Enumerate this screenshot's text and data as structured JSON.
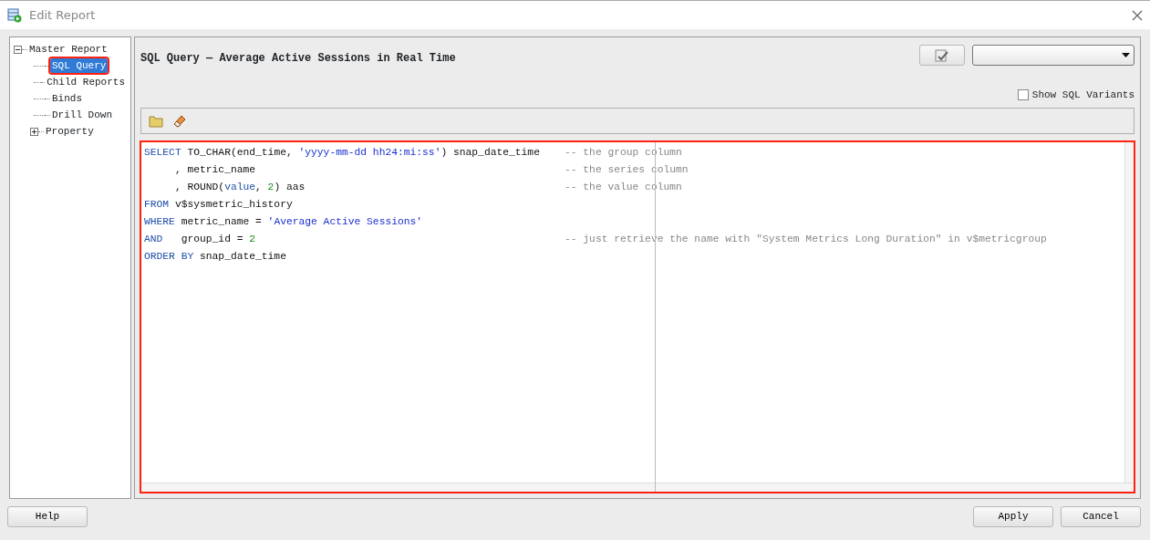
{
  "window": {
    "title": "Edit Report"
  },
  "tree": [
    {
      "label": "Master Report",
      "expanded": true,
      "selected": false,
      "highlighted": false,
      "children": [
        {
          "label": "SQL Query",
          "selected": true,
          "highlighted": true
        },
        {
          "label": "Child Reports",
          "selected": false,
          "highlighted": false
        },
        {
          "label": "Binds",
          "selected": false,
          "highlighted": false
        },
        {
          "label": "Drill Down",
          "selected": false,
          "highlighted": false
        },
        {
          "label": "Property",
          "expanded": false,
          "selected": false,
          "highlighted": false
        }
      ]
    }
  ],
  "panel": {
    "title": "SQL Query — Average Active Sessions in Real Time",
    "show_sql_variants": {
      "label": "Show SQL Variants",
      "checked": false
    }
  },
  "editor": {
    "highlighted": true,
    "lines": [
      {
        "tokens": [
          {
            "kind": "keyword",
            "text": "SELECT"
          },
          {
            "kind": "plain",
            "text": " TO_CHAR(end_time, "
          },
          {
            "kind": "string",
            "text": "'yyyy-mm-dd hh24:mi:ss'"
          },
          {
            "kind": "plain",
            "text": ") snap_date_time"
          }
        ],
        "comment": "-- the group column"
      },
      {
        "tokens": [
          {
            "kind": "plain",
            "text": "     , metric_name"
          }
        ],
        "comment": "-- the series column"
      },
      {
        "tokens": [
          {
            "kind": "plain",
            "text": "     , ROUND("
          },
          {
            "kind": "keyword",
            "text": "value"
          },
          {
            "kind": "plain",
            "text": ", "
          },
          {
            "kind": "number",
            "text": "2"
          },
          {
            "kind": "plain",
            "text": ") aas"
          }
        ],
        "comment": "-- the value column"
      },
      {
        "tokens": [
          {
            "kind": "keyword",
            "text": "FROM"
          },
          {
            "kind": "plain",
            "text": " v$sysmetric_history"
          }
        ]
      },
      {
        "tokens": [
          {
            "kind": "keyword",
            "text": "WHERE"
          },
          {
            "kind": "plain",
            "text": " metric_name = "
          },
          {
            "kind": "string",
            "text": "'Average Active Sessions'"
          }
        ]
      },
      {
        "tokens": [
          {
            "kind": "keyword",
            "text": "AND"
          },
          {
            "kind": "plain",
            "text": "   group_id = "
          },
          {
            "kind": "number",
            "text": "2"
          }
        ],
        "comment": "-- just retrieve the name with \"System Metrics Long Duration\" in v$metricgroup"
      },
      {
        "tokens": [
          {
            "kind": "keyword",
            "text": "ORDER BY"
          },
          {
            "kind": "plain",
            "text": " snap_date_time"
          }
        ]
      }
    ]
  },
  "buttons": [
    {
      "label": "Help",
      "kind": "left"
    },
    {
      "label": "Apply",
      "kind": "right"
    },
    {
      "label": "Cancel",
      "kind": "right"
    }
  ]
}
